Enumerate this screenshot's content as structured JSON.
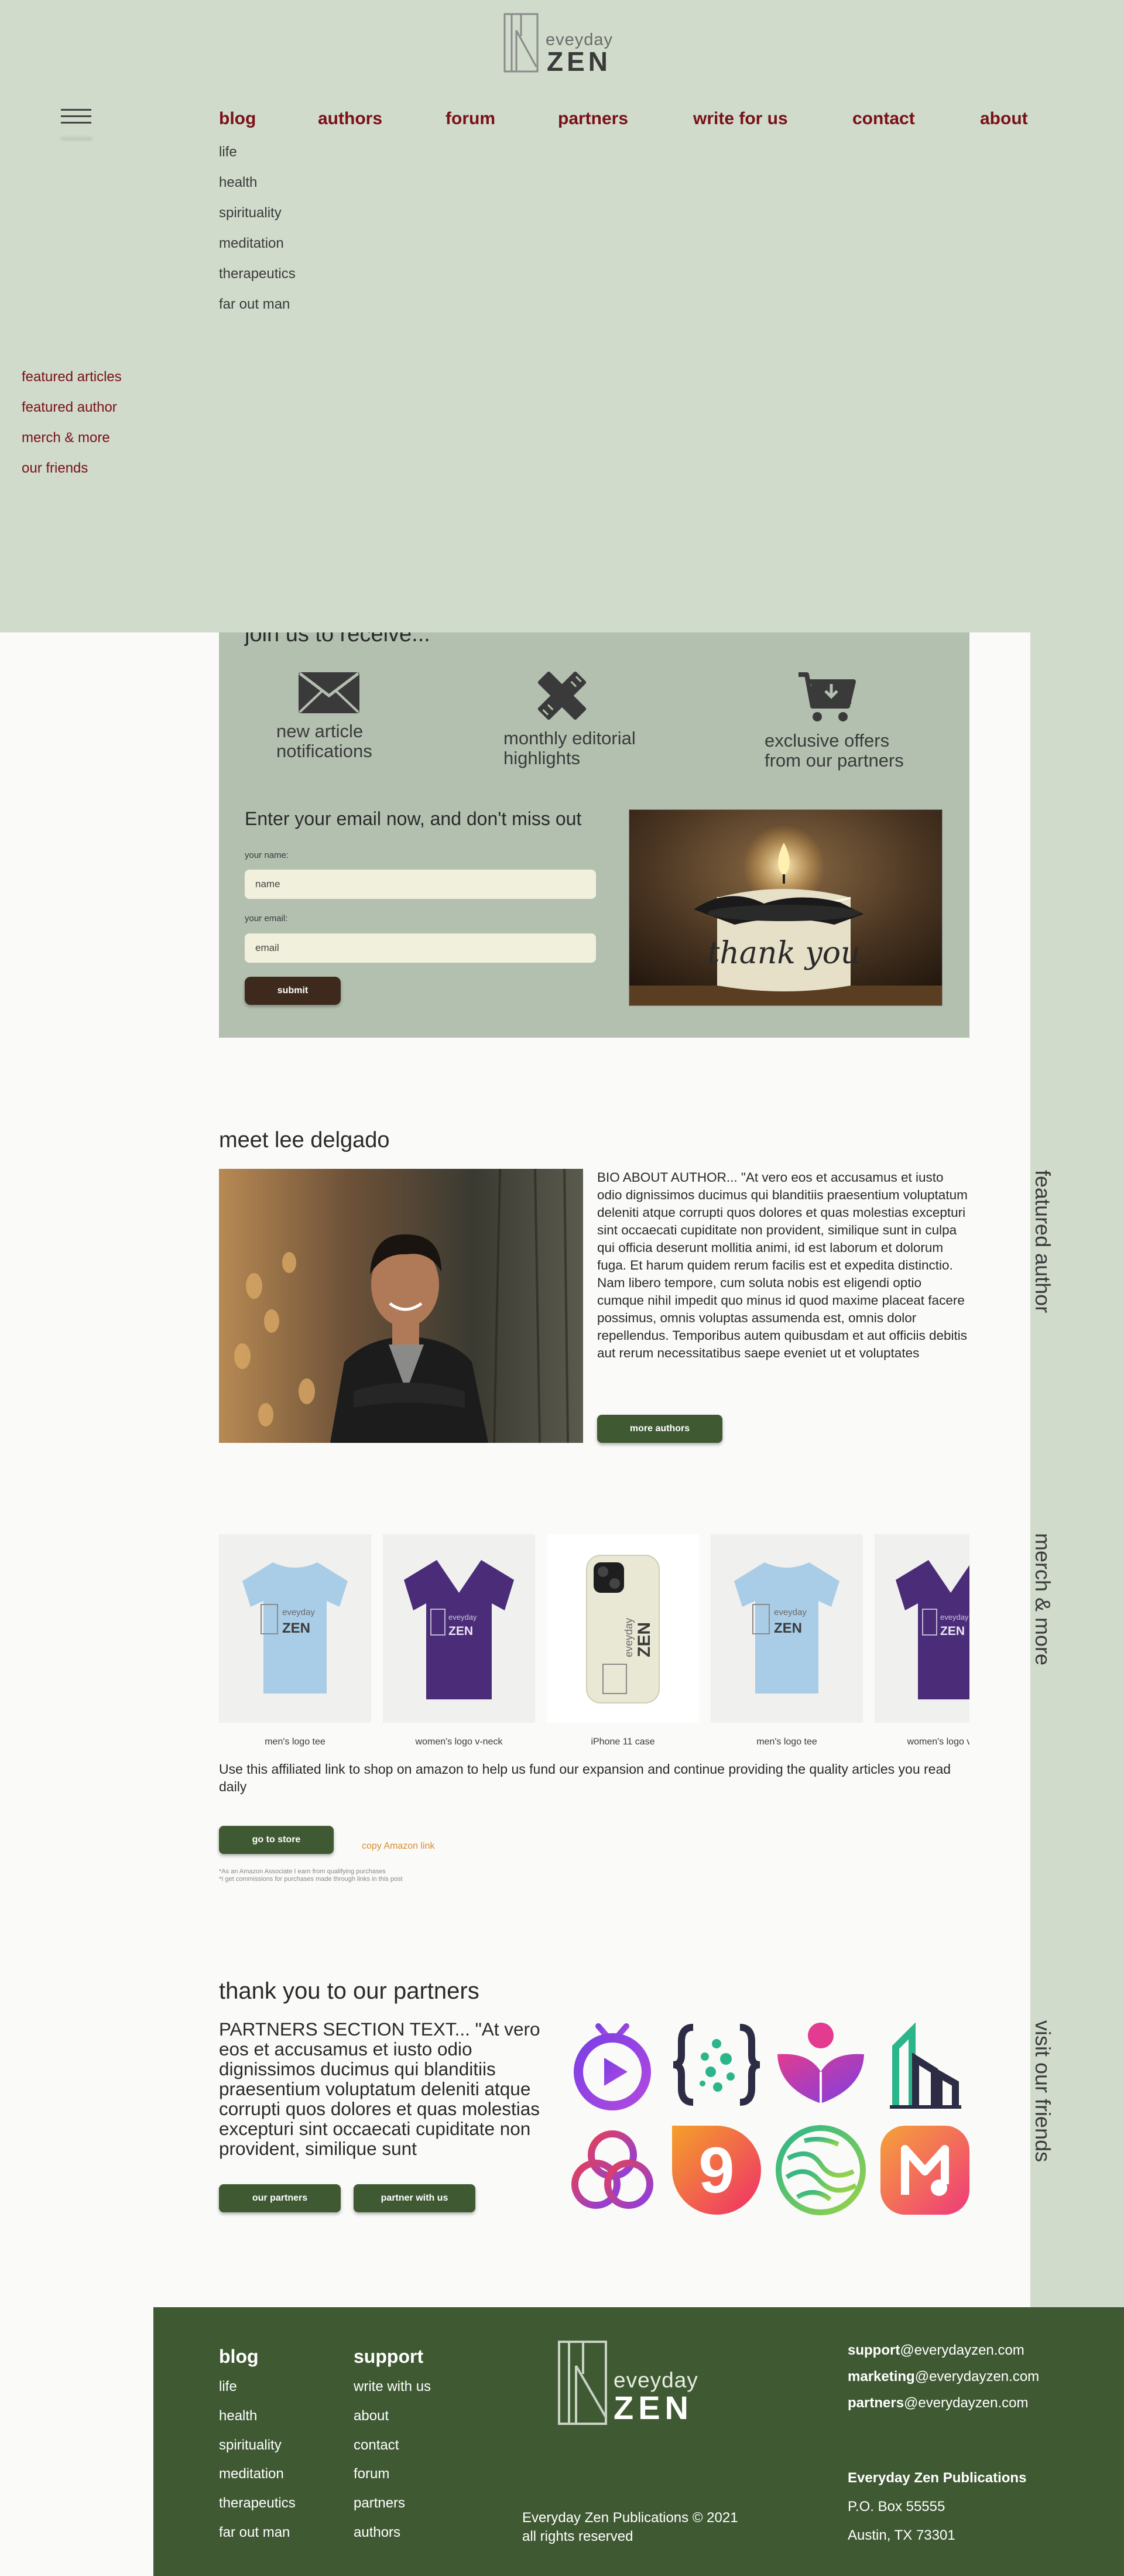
{
  "brand": {
    "logo_top": "eveyday",
    "logo_bottom": "ZEN"
  },
  "nav": {
    "menu_icon": "hamburger-menu-icon",
    "items": [
      {
        "label": "blog"
      },
      {
        "label": "authors"
      },
      {
        "label": "forum"
      },
      {
        "label": "partners"
      },
      {
        "label": "write for us"
      },
      {
        "label": "contact"
      },
      {
        "label": "about"
      }
    ],
    "blog_submenu": [
      "life",
      "health",
      "spirituality",
      "meditation",
      "therapeutics",
      "far out man"
    ]
  },
  "page_menu": [
    "featured articles",
    "featured author",
    "merch & more",
    "our friends"
  ],
  "rail_labels": {
    "featured_author": "featured author",
    "merch": "merch & more",
    "friends": "visit our friends"
  },
  "subscribe": {
    "partial_heading": "join us to receive...",
    "benefits": [
      {
        "icon": "envelope-icon",
        "text": "new article\nnotifications"
      },
      {
        "icon": "pencil-ruler-icon",
        "text": "monthly editorial\nhighlights"
      },
      {
        "icon": "cart-download-icon",
        "text": "exclusive offers\nfrom our partners"
      }
    ],
    "form_heading": "Enter your email now, and don't miss out",
    "name_label": "your name:",
    "name_placeholder": "name",
    "email_label": "your email:",
    "email_placeholder": "email",
    "submit_label": "submit",
    "image_text": "thank you"
  },
  "author": {
    "heading": "meet lee delgado",
    "bio": "BIO ABOUT AUTHOR... \"At vero eos et accusamus et iusto odio dignissimos ducimus qui blanditiis praesentium voluptatum deleniti atque corrupti quos dolores et quas molestias excepturi sint occaecati cupiditate non provident, similique sunt in culpa qui officia deserunt mollitia animi, id est laborum et dolorum fuga. Et harum quidem rerum facilis est et expedita distinctio. Nam libero tempore, cum soluta nobis est eligendi optio cumque nihil impedit quo minus id quod maxime placeat facere possimus, omnis voluptas assumenda est, omnis dolor repellendus. Temporibus autem quibusdam et aut officiis debitis aut rerum necessitatibus saepe eveniet ut et voluptates",
    "button_label": "more authors"
  },
  "merch": {
    "items": [
      {
        "caption": "men's logo tee",
        "kind": "tee",
        "color": "#a9cde6"
      },
      {
        "caption": "women's logo v-neck",
        "kind": "vneck",
        "color": "#4a2c78"
      },
      {
        "caption": "iPhone 11 case",
        "kind": "case",
        "color": "#e9e8d4"
      },
      {
        "caption": "men's logo tee",
        "kind": "tee",
        "color": "#a9cde6"
      },
      {
        "caption": "women's logo v-neck",
        "kind": "vneck",
        "color": "#4a2c78"
      }
    ],
    "note": "Use this affiliated link to shop on amazon to help us fund our expansion and continue providing the quality articles you read daily",
    "store_button": "go to store",
    "copy_link": "copy Amazon link",
    "disclaimer": "*As an Amazon Associate I earn from qualifying purchases\n*I get commissions for purchases made through links in this post"
  },
  "partners": {
    "heading": "thank you to our partners",
    "text": "PARTNERS SECTION TEXT... \"At vero eos et accusamus et iusto odio dignissimos ducimus qui blanditiis praesentium voluptatum deleniti atque corrupti quos dolores et quas molestias excepturi sint occaecati cupiditate non provident, similique sunt",
    "our_partners_button": "our partners",
    "partner_with_us_button": "partner with us",
    "logos": [
      "play-tv-icon",
      "code-braces-icon",
      "person-book-icon",
      "building-icon",
      "triple-loop-icon",
      "nine-badge-icon",
      "globe-lines-icon",
      "music-m-icon"
    ],
    "logo_numeral": "9"
  },
  "footer": {
    "blog_heading": "blog",
    "blog_links": [
      "life",
      "health",
      "spirituality",
      "meditation",
      "therapeutics",
      "far out man"
    ],
    "support_heading": "support",
    "support_links": [
      "write with us",
      "about",
      "contact",
      "forum",
      "partners",
      "authors"
    ],
    "logo_top": "eveyday",
    "logo_bottom": "ZEN",
    "copyright": "Everyday Zen Publications © 2021\nall rights reserved",
    "emails": [
      {
        "user": "support",
        "domain": "@everydayzen.com"
      },
      {
        "user": "marketing",
        "domain": "@everydayzen.com"
      },
      {
        "user": "partners",
        "domain": "@everydayzen.com"
      }
    ],
    "company": "Everyday Zen Publications",
    "po_box": "P.O. Box 55555",
    "city": "Austin, TX 73301"
  },
  "colors": {
    "header_bg": "#d0dbcb",
    "accent_red": "#7a1018",
    "footer_green": "#3f5a33",
    "button_green": "#3f5a33",
    "subscribe_bg": "#b3c0b0",
    "submit_brown": "#3d2a1c",
    "link_orange": "#d98c2e"
  }
}
